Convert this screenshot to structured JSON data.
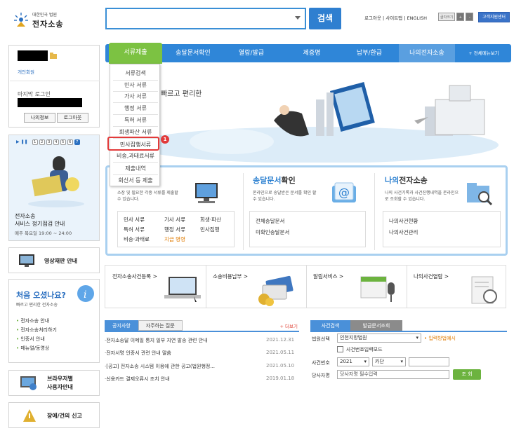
{
  "logo": {
    "sub": "대한민국 법원",
    "title": "전자소송"
  },
  "header": {
    "search_button": "검색",
    "util_links": "로그아웃 | 사이트맵 | ENGLISH",
    "font_label": "글자크기",
    "font_plus": "+",
    "font_minus": "-",
    "customer_center": "고객지원센터"
  },
  "nav": {
    "items": [
      "서류제출",
      "송달문서확인",
      "열람/발급",
      "제증명",
      "납부/환급",
      "나의전자소송"
    ],
    "all_menu": "+ 전체메뉴보기"
  },
  "dropdown": {
    "items": [
      "서류검색",
      "민사 서류",
      "가사 서류",
      "행정 서류",
      "특허 서류",
      "회생파산 서류",
      "민사집행서류",
      "비송,과태료서류",
      "제출내역",
      "회신서 등 제출"
    ],
    "highlighted_index": 6,
    "badge": "1"
  },
  "login": {
    "member_type": "개인회원",
    "last_login_label": "마지막 로그인",
    "my_info": "나의정보",
    "logout": "로그아웃"
  },
  "banner": {
    "title": "전자소송",
    "subtitle": "서비스 정기점검 안내",
    "time": "매주 목요일 19:00 ~ 24:00",
    "page_nums": [
      "1",
      "2",
      "3",
      "4",
      "5",
      "6",
      "7"
    ]
  },
  "side": {
    "video_trial": "영상재판 안내",
    "first_title": "처음 오셨나요?",
    "first_sub": "빠르고 편리한 전자소송",
    "first_links": [
      "전자소송 안내",
      "전자소송처리하기",
      "인증서 안내",
      "매뉴얼/동영상"
    ],
    "browser_line1": "브라우저별",
    "browser_line2": "사용자안내",
    "report": "장애/건의 신고"
  },
  "hero": {
    "text": "빠르고 편리한"
  },
  "panels": [
    {
      "title": "",
      "desc": "소장 및 필요한 각종 서류를 제출할 수 있습니다.",
      "links": [
        "민사 서류",
        "가사 서류",
        "회생·파산",
        "특허 서류",
        "행정 서류",
        "민사집행",
        "비송·과태료",
        "지급 명령"
      ]
    },
    {
      "title_a": "송달문서",
      "title_b": "확인",
      "desc": "온라인으로 송달받은 문서를 확인 할 수 있습니다.",
      "links": [
        "전체송달문서",
        "미확인송달문서"
      ]
    },
    {
      "title_a": "나의",
      "title_b": "전자소송",
      "desc": "나의 사건기록과 사건진행내역을 온라인으로 조회할 수 있습니다.",
      "links": [
        "나의사건현황",
        "나의사건관리"
      ]
    }
  ],
  "strip": [
    "전자소송사건등록 >",
    "소송비용납부 >",
    "알림서비스 >",
    "나의사건열람 >"
  ],
  "notice": {
    "tab_on": "공지사항",
    "tab_off": "자주하는 질문",
    "more": "+ 더보기",
    "rows": [
      {
        "t": "·전자소송달 이메일 통지 일부 지연 발송 관련 안내",
        "d": "2021.12.31"
      },
      {
        "t": "·전자서명 인증서 관련 안내 말씀",
        "d": "2021.05.11"
      },
      {
        "t": "·[공고] 전자소송 시스템 이용에 관한 공고(법원행정...",
        "d": "2021.05.10"
      },
      {
        "t": "·신용카드 결제오류시 조치 안내",
        "d": "2019.01.18"
      }
    ]
  },
  "case": {
    "tab_on": "사건검색",
    "tab_off": "발급문서조회",
    "court_label": "법원선택",
    "court_value": "인천지방법원",
    "input_help": "입력방법예시",
    "case_number_mode": "사건번호입력모드",
    "case_no_label": "사건번호",
    "year": "2021",
    "kind": "카단",
    "party_label": "당사자명",
    "party_placeholder": "당사자명 필수입력",
    "search": "조 회"
  },
  "colors": {
    "nav": "#2f86d8",
    "nav_active": "#7cc242",
    "highlight": "#e23a3a"
  }
}
